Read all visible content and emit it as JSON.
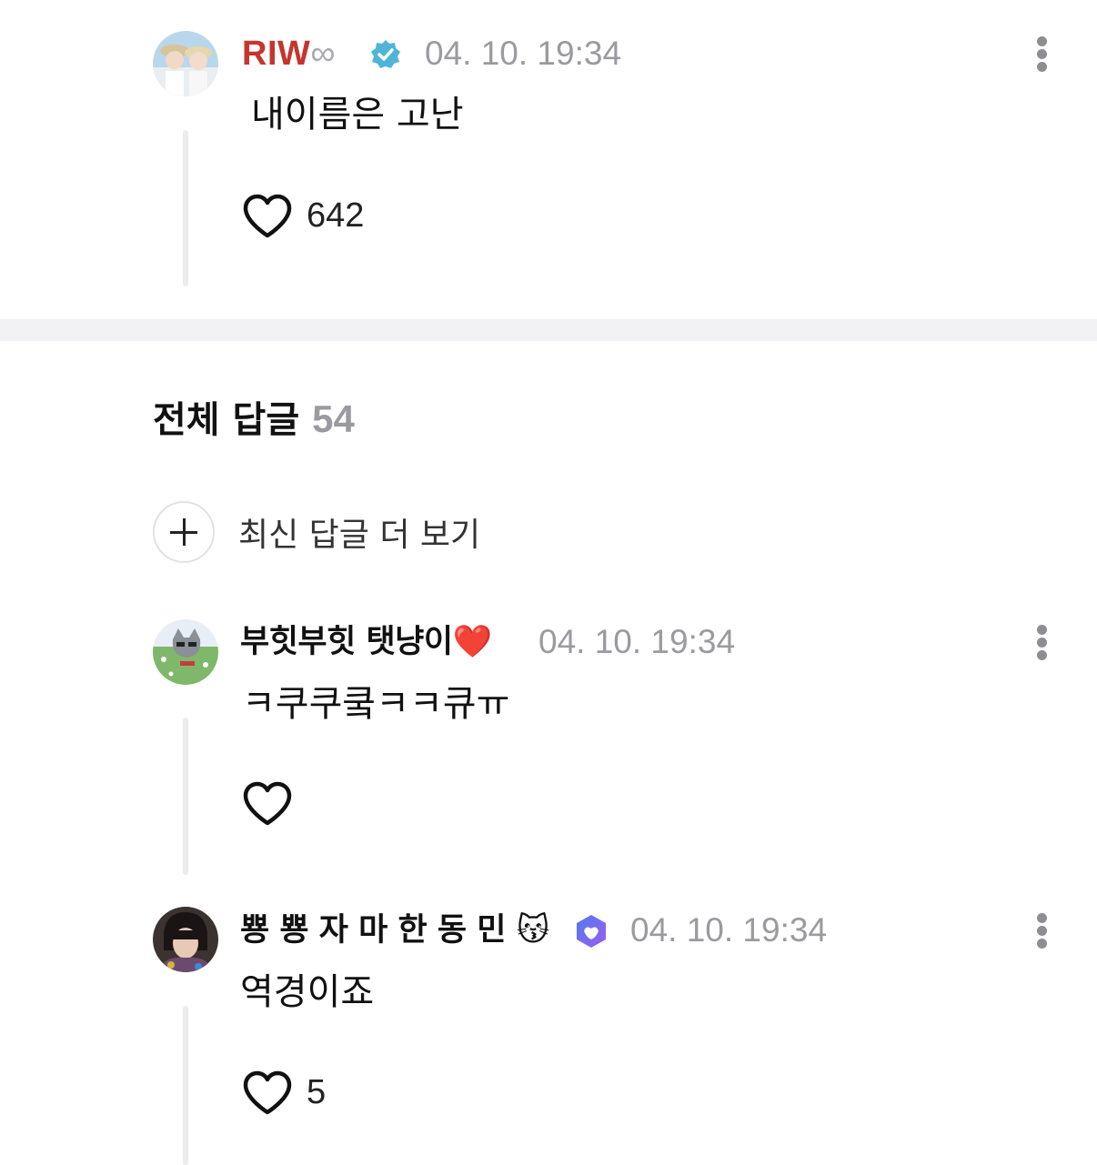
{
  "original_comment": {
    "author": "RIW",
    "author_suffix": "∞",
    "verified_icon": "verified-check-icon",
    "timestamp": "04. 10. 19:34",
    "text": "내이름은 고난",
    "likes": "642",
    "author_color": "#c5352e"
  },
  "replies_section": {
    "title": "전체 답글",
    "count": "54",
    "more_label": "최신 답글 더 보기"
  },
  "replies": [
    {
      "author": "부힛부힛 탯냥이❤️",
      "timestamp": "04. 10. 19:34",
      "text": "ㅋ쿠쿠쿸ㅋㅋ큐ㅠ",
      "likes": ""
    },
    {
      "author": "뿅 뿅 자 마 한 동 민 😽",
      "badge_icon": "fan-badge-icon",
      "timestamp": "04. 10. 19:34",
      "text": "역경이죠",
      "likes": "5"
    }
  ]
}
